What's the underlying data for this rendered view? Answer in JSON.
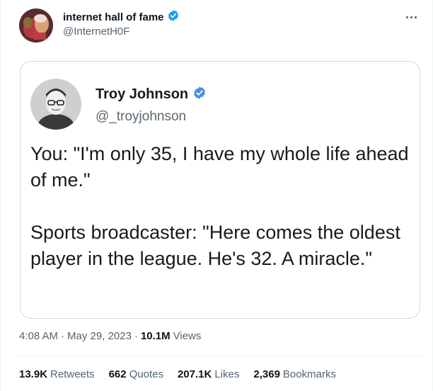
{
  "author": {
    "display_name": "internet hall of fame",
    "handle": "@InternetH0F",
    "verified_color": "#1d9bf0"
  },
  "quoted": {
    "display_name": "Troy Johnson",
    "handle": "@_troyjohnson",
    "paragraphs": [
      "You: \"I'm only 35, I have my whole life ahead of me.\"",
      "Sports broadcaster: \"Here comes the oldest player in the league. He's 32. A miracle.\""
    ]
  },
  "meta": {
    "time": "4:08 AM",
    "date": "May 29, 2023",
    "views_count": "10.1M",
    "views_label": "Views"
  },
  "stats": [
    {
      "value": "13.9K",
      "label": "Retweets"
    },
    {
      "value": "662",
      "label": "Quotes"
    },
    {
      "value": "207.1K",
      "label": "Likes"
    },
    {
      "value": "2,369",
      "label": "Bookmarks"
    }
  ],
  "icons": {
    "more": "more-options-icon",
    "verified": "verified-badge-icon"
  },
  "colors": {
    "text": "#0f1419",
    "secondary": "#536471",
    "border": "#cfd9de",
    "accent": "#1d9bf0"
  }
}
